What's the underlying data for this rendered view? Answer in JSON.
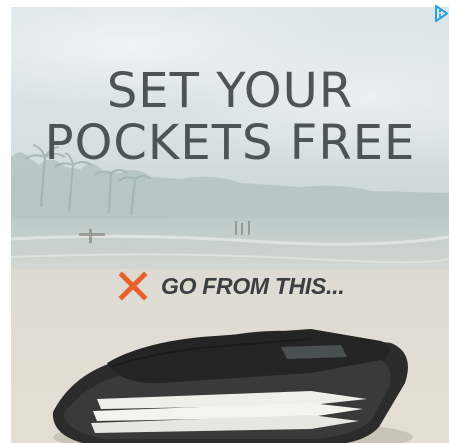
{
  "ad": {
    "headline_line1": "SET YOUR",
    "headline_line2": "POCKETS FREE",
    "cta_text": "GO FROM THIS...",
    "cta_icon": "x-mark-icon",
    "ad_choices_icon": "ad-choices-icon"
  },
  "colors": {
    "headline": "#4d5458",
    "x_mark": "#e8612c",
    "cta_text": "#3b3f42",
    "ad_choices": "#2aa3d6"
  }
}
